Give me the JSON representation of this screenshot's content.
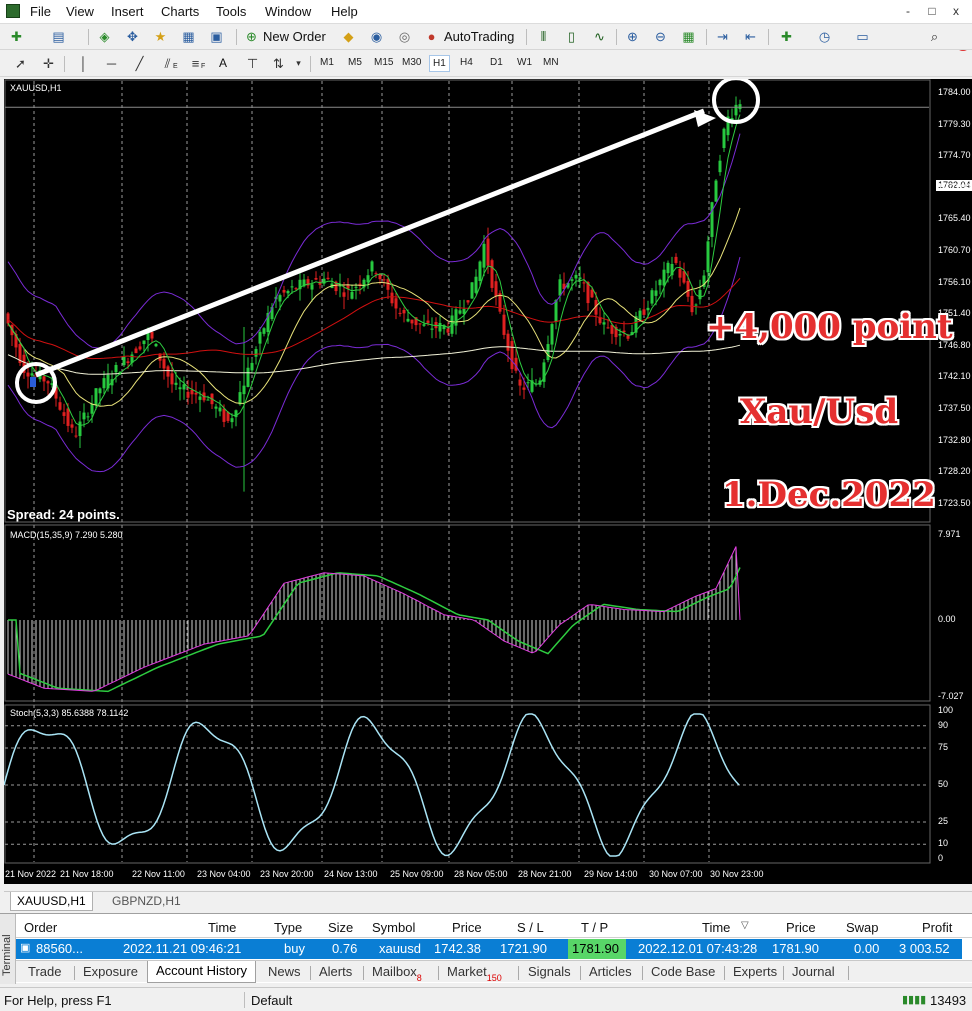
{
  "menu": {
    "items": [
      "File",
      "View",
      "Insert",
      "Charts",
      "Tools",
      "Window",
      "Help"
    ],
    "window_controls": [
      "-",
      "□",
      "x"
    ]
  },
  "toolbar": {
    "new_order": "New Order",
    "autotrading": "AutoTrading",
    "line_tools": [
      "E",
      "F",
      "A"
    ],
    "timeframes": [
      "M1",
      "M5",
      "M15",
      "M30",
      "H1",
      "H4",
      "D1",
      "W1",
      "MN"
    ],
    "active_timeframe": "H1",
    "notification_count": "1"
  },
  "chart": {
    "symbol_label": "XAUUSD,H1",
    "spread": "Spread: 24 points.",
    "current_price": "1782.04",
    "price_labels": [
      "1784.00",
      "1779.30",
      "1774.70",
      "1770.00",
      "1765.40",
      "1760.70",
      "1756.10",
      "1751.40",
      "1746.80",
      "1742.10",
      "1737.50",
      "1732.80",
      "1728.20",
      "1723.50"
    ],
    "macd_label": "MACD(15,35,9) 7.290 5.280",
    "macd_scale": [
      "7.971",
      "0.00",
      "-7.027"
    ],
    "stoch_label": "Stoch(5,3,3) 85.6388 78.1142",
    "stoch_scale": [
      "100",
      "90",
      "75",
      "50",
      "25",
      "10",
      "0"
    ],
    "time_labels": [
      "21 Nov 2022",
      "21 Nov 18:00",
      "22 Nov 11:00",
      "23 Nov 04:00",
      "23 Nov 20:00",
      "24 Nov 13:00",
      "25 Nov 09:00",
      "28 Nov 05:00",
      "28 Nov 21:00",
      "29 Nov 14:00",
      "30 Nov 07:00",
      "30 Nov 23:00"
    ],
    "colors": {
      "background": "#000000",
      "bull": "#27c93f",
      "bear": "#e02020",
      "bollinger": "#7a2bd6",
      "ma_slow": "#d11010",
      "ma_mid": "#e8e27a",
      "ma_long": "#f2f2d8",
      "ma_fast": "#2ecc40",
      "stoch": "#a9e4f5"
    }
  },
  "annotations": {
    "points": "+4,000 point",
    "pair": "Xau/Usd",
    "date": "1.Dec.2022"
  },
  "symbol_tabs": [
    "XAUUSD,H1",
    "GBPNZD,H1"
  ],
  "terminal": {
    "side_label": "Terminal",
    "columns": [
      "Order",
      "Time",
      "Type",
      "Size",
      "Symbol",
      "Price",
      "S / L",
      "T / P",
      "Time",
      "Price",
      "Swap",
      "Profit"
    ],
    "row": {
      "order": "88560...",
      "open_time": "2022.11.21 09:46:21",
      "type": "buy",
      "size": "0.76",
      "symbol": "xauusd",
      "open_price": "1742.38",
      "sl": "1721.90",
      "tp": "1781.90",
      "close_time": "2022.12.01 07:43:28",
      "close_price": "1781.90",
      "swap": "0.00",
      "profit": "3 003.52"
    },
    "tabs": [
      "Trade",
      "Exposure",
      "Account History",
      "News",
      "Alerts",
      "Mailbox",
      "Market",
      "Signals",
      "Articles",
      "Code Base",
      "Experts",
      "Journal"
    ],
    "mailbox_badge": "8",
    "market_badge": "150",
    "active_tab": "Account History"
  },
  "statusbar": {
    "help": "For Help, press F1",
    "profile": "Default",
    "traffic": "13493"
  }
}
